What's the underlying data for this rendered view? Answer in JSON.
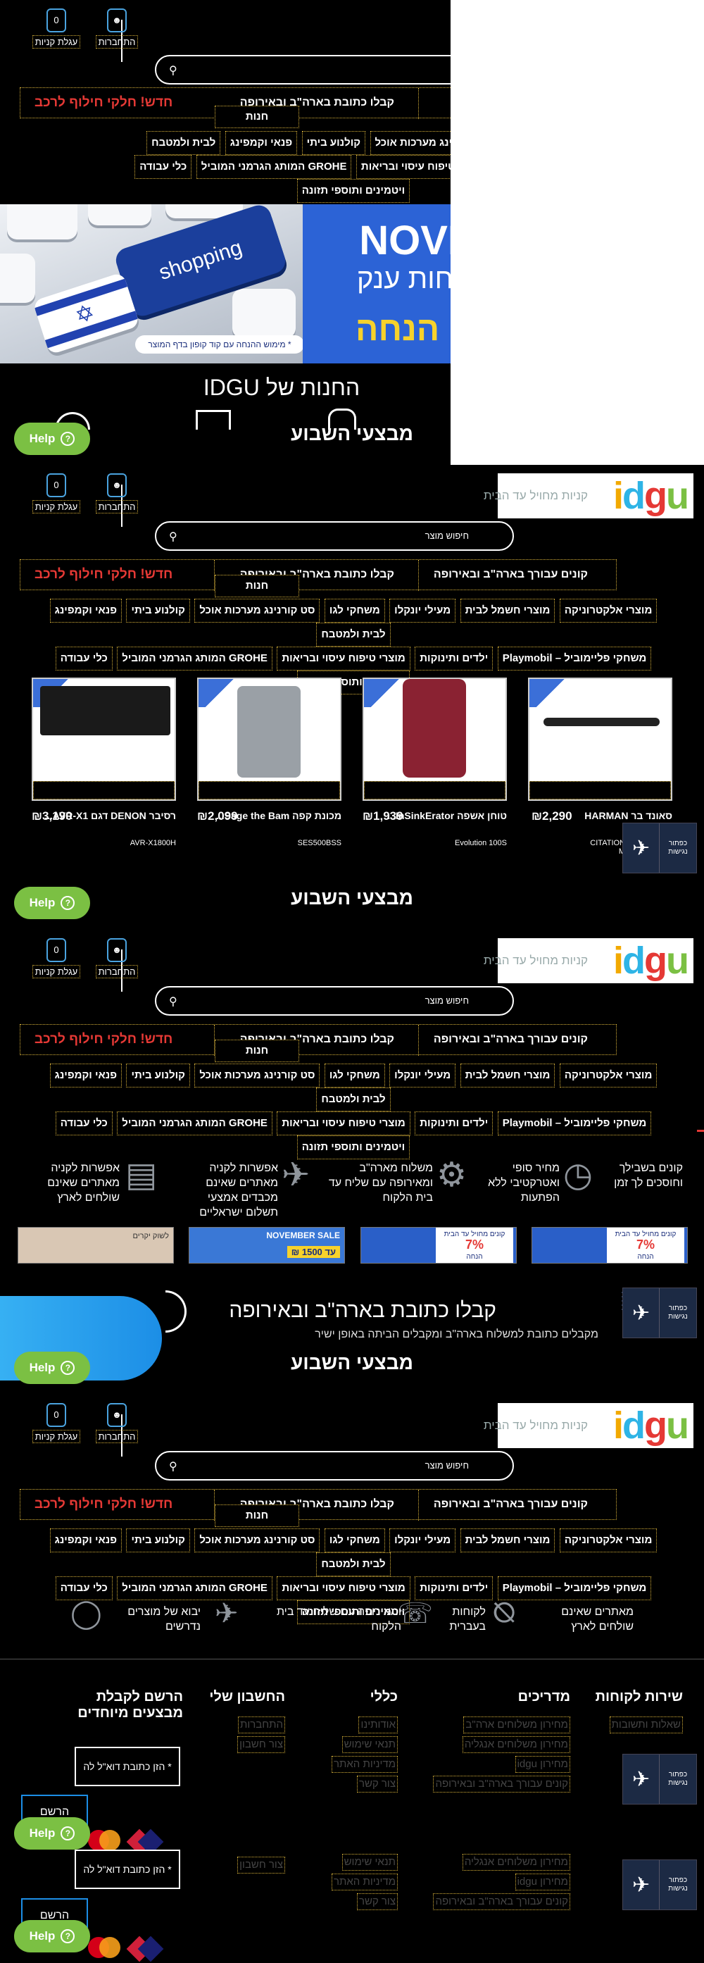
{
  "help_label": "Help",
  "deals_title": "מבצעי השבוע",
  "stores_title": "החנות של IDGU",
  "logo": {
    "text": "idgu",
    "tagline": "קניות מחויל עד הבית"
  },
  "header": {
    "signup_label": "התחברות",
    "cart_label": "עגלת קניות",
    "cart_count": "0",
    "search_placeholder": "חיפוש מוצר"
  },
  "nav": {
    "buy_usa_eu": "קונים עבורך בארה\"ב ובאירופה",
    "get_address": "קבלו כתובת בארה\"ב ובאירופה",
    "new_parts": "חדש! חלקי חילוף לרכב",
    "stores": "חנות"
  },
  "categories": [
    "מוצרי אלקטרוניקה",
    "מוצרי חשמל לבית",
    "מעילי יונקלו",
    "משחקי לגו",
    "סט קורנינג מערכות אוכל",
    "קולנוע ביתי",
    "פנאי וקמפינג",
    "לבית ולמטבח",
    "משחקי פליימוביל – Playmobil",
    "ילדים ותינוקות",
    "מוצרי טיפוח עיסוי ובריאות",
    "GROHE המותג הגרמני המוביל",
    "כלי עבודה",
    "ויטמינים ותוספי תזונה"
  ],
  "promo": {
    "keyboard_key": "shopping",
    "coupon_note": "* מימוש ההנחה עם קוד קופון בדף המוצר",
    "banner_title": "NOVI",
    "banner_sub": "חות ענק",
    "banner_discount": "ה הנחה"
  },
  "products": [
    {
      "title": "סאונד בר HARMAN",
      "price": "₪2,290",
      "sku": "CITATION M"
    },
    {
      "title": "טוחן אשפה InSinkErator...",
      "price": "₪1,939",
      "sku": "Evolution 100S"
    },
    {
      "title": "מכונת קפה Sage the Bam...",
      "price": "₪2,099",
      "sku": "SES500BSS"
    },
    {
      "title": "רסיבר DENON דגם AVR-X1...",
      "price": "₪3,190",
      "sku": "AVR-X1800H"
    }
  ],
  "accessibility": {
    "label": "כפתור נגישות"
  },
  "features": [
    "קונים בשבילך וחוסכים לך זמן",
    "מחיר סופי ואטרקטיבי ללא הפתעות",
    "משלוח מארה\"ב ומאירופה עם שליח עד בית הלקוח",
    "אפשרות לקניה מאתרים שאינם מכבדים אמצעי תשלום ישראליים",
    "אפשרות לקניה מאתרים שאינם שולחים לארץ"
  ],
  "features2": [
    "מאתרים שאינם שולחים לארץ",
    "לקוחות בעברית",
    "ומאירופה עם שליח עד בית הלקוח",
    "יבוא של מוצרים נדרשים"
  ],
  "banners": [
    {
      "line1": "קונים מחויל עד הבית",
      "line2": "7%",
      "line3": "הנחה"
    },
    {
      "line1": "קונים מחויל עד הבית",
      "line2": "7%",
      "line3": "הנחה"
    },
    {
      "line1": "NOVEMBER SALE",
      "line2": "עד 1500 ₪"
    },
    {
      "line1": "לשוק יקרים"
    }
  ],
  "get_address_section": {
    "title": "קבלו כתובת בארה\"ב ובאירופה",
    "sub": "מקבלים כתובת למשלוח בארה\"ב ומקבלים הביתה באופן ישיר"
  },
  "footer": {
    "col_customer": "שירות לקוחות",
    "col_guides": "מדריכים",
    "col_general": "כללי",
    "col_account": "החשבון שלי",
    "col_signup": "הרשם לקבלת מבצעים מיוחדים",
    "customer_links": [
      "שאלות ותשובות"
    ],
    "guides_links": [
      "מחירון משלוחים ארה\"ב",
      "מחירון משלוחים אנגליה",
      "מחירון idgu",
      "קונים עבורך בארה\"ב ובאירופה"
    ],
    "general_links": [
      "אודותינו",
      "תנאי שימוש",
      "מדיניות האתר",
      "צור קשר"
    ],
    "account_links": [
      "התחברות",
      "צור חשבון"
    ],
    "email_placeholder": "* הזן כתובת דוא\"ל לה",
    "send_label": "הרשם",
    "card_brand": "MasterCard",
    "colors": {
      "visa": "#1a1f71",
      "mc_red": "#eb001b",
      "mc_orange": "#f79e1b"
    }
  }
}
